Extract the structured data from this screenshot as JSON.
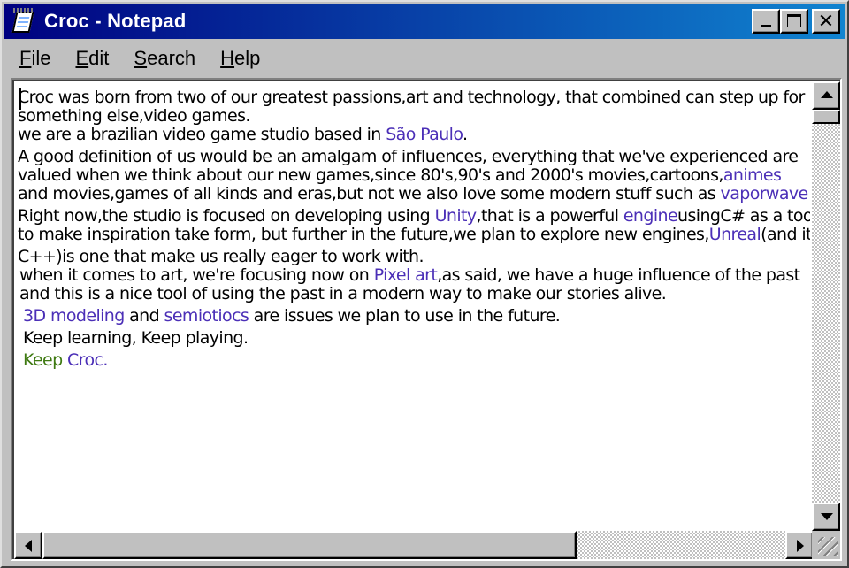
{
  "window": {
    "title": "Croc - Notepad",
    "icon": "notepad-icon",
    "controls": {
      "minimize": "minimize-icon",
      "maximize": "maximize-icon",
      "close_glyph": "✕"
    }
  },
  "menu": {
    "items": [
      {
        "label_ul": "F",
        "label_rest": "ile"
      },
      {
        "label_ul": "E",
        "label_rest": "dit"
      },
      {
        "label_ul": "S",
        "label_rest": "earch"
      },
      {
        "label_ul": "H",
        "label_rest": "elp"
      }
    ]
  },
  "colors": {
    "title_start": "#000080",
    "title_end": "#1084d0",
    "link": "#4b2fb7",
    "green": "#3f7a12"
  },
  "document": {
    "p1": {
      "l1": "Croc was born from two of our greatest passions,art and technology, that combined can step up for",
      "l2": "something else,video games.",
      "l3_pre": "we  are a brazilian video game studio based in ",
      "l3_link": "São Paulo",
      "l3_post": "."
    },
    "p2": {
      "l1": "A good definition of us would be an amalgam of influences, everything that we've experienced are",
      "l2_pre": "valued when we think about our new games,since 80's,90's and 2000's movies,cartoons,",
      "l2_link": "animes",
      "l3_pre": "and movies,games of all kinds and eras,but not we also love some modern stuff such as ",
      "l3_link": "vaporwave"
    },
    "p3": {
      "l1_pre": "Right now,the studio is focused on developing using ",
      "l1_link1": "Unity",
      "l1_mid": ",that is a powerful ",
      "l1_link2": "engine",
      "l1_post": "usingC# as a tool",
      "l2_pre": "to make inspiration take form, but further in the future,we plan to explore new engines,",
      "l2_link": "Unreal",
      "l2_post": "(and its"
    },
    "p4": {
      "l1": "C++)is one that make us really eager to work with.",
      "l2_pre": "when it comes to art, we're focusing now on ",
      "l2_link": "Pixel art",
      "l2_post": ",as said, we have a huge influence of the past",
      "l3": "and this is a nice tool of using the past in a modern way to make our stories alive."
    },
    "p5": {
      "link1": "3D modeling",
      "mid": " and ",
      "link2": "semiotiocs",
      "post": " are issues we plan to use in the future."
    },
    "p6": {
      "text": "Keep learning, Keep playing."
    },
    "p7": {
      "green": "Keep ",
      "link": "Croc."
    }
  }
}
